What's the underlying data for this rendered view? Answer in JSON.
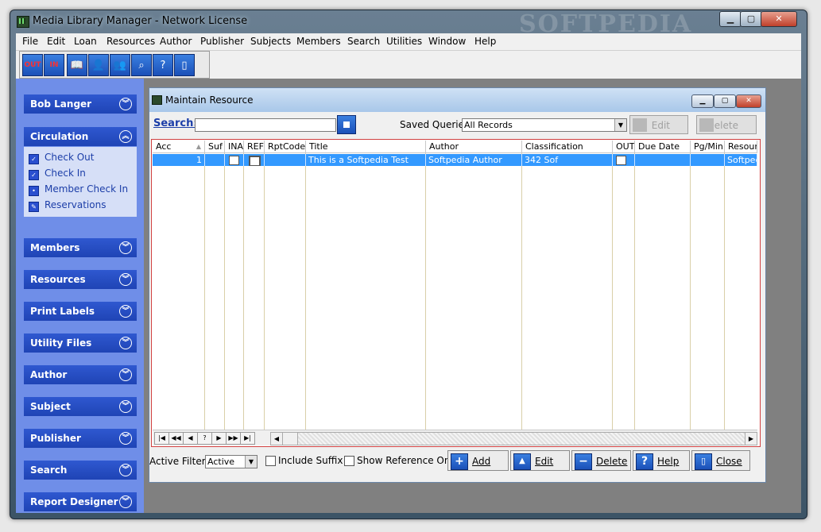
{
  "window": {
    "title": "Media Library Manager - Network License",
    "watermark": "SOFTPEDIA"
  },
  "menu": [
    "File",
    "Edit",
    "Loan",
    "Resources",
    "Author",
    "Publisher",
    "Subjects",
    "Members",
    "Search",
    "Utilities",
    "Window",
    "Help"
  ],
  "toolbar": {
    "checkout": "OUT",
    "checkin": "IN"
  },
  "sidebar": {
    "user": "Bob Langer",
    "circulation": "Circulation",
    "circulation_items": [
      "Check Out",
      "Check In",
      "Member Check In",
      "Reservations"
    ],
    "sections": [
      "Members",
      "Resources",
      "Print Labels",
      "Utility Files",
      "Author",
      "Subject",
      "Publisher",
      "Search",
      "Report Designer"
    ]
  },
  "child": {
    "title": "Maintain Resource",
    "search_label": "Search:",
    "search_value": "",
    "saved_queries_label": "Saved Queries:",
    "saved_queries_value": "All Records",
    "edit_label": "Edit",
    "delete_label": "Delete"
  },
  "grid": {
    "columns": [
      "Acc",
      "Suf",
      "INA",
      "REF",
      "RptCode",
      "Title",
      "Author",
      "Classification",
      "OUT",
      "Due Date",
      "Pg/Min",
      "Resource"
    ],
    "row": {
      "acc": "1",
      "title": "This is a Softpedia Test",
      "author": "Softpedia Author",
      "classification": "342 Sof",
      "resource": "Softpedia"
    },
    "nav": [
      "|◀",
      "◀◀",
      "◀",
      "?",
      "▶",
      "▶▶",
      "▶|"
    ]
  },
  "bottom": {
    "active_filter_label": "Active Filter:",
    "active_filter_value": "Active",
    "include_suffix": "Include Suffix",
    "show_reference_only": "Show Reference Only",
    "add": "Add",
    "edit": "Edit",
    "delete": "Delete",
    "help": "Help",
    "close": "Close"
  }
}
